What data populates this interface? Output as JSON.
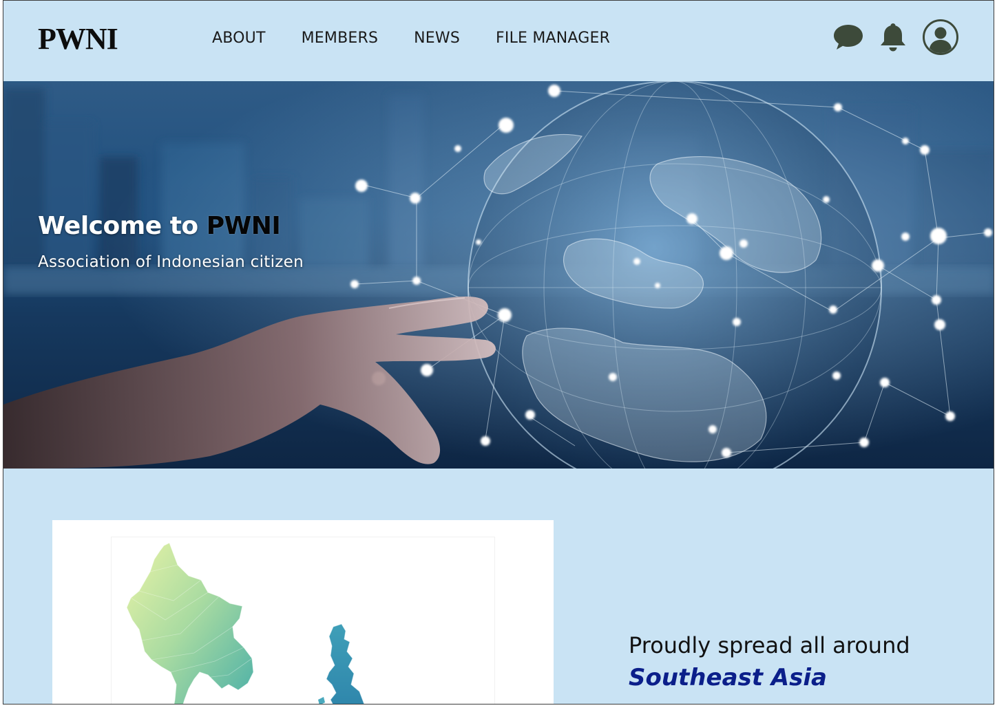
{
  "header": {
    "logo": "PWNI",
    "nav": [
      "ABOUT",
      "MEMBERS",
      "NEWS",
      "FILE MANAGER"
    ],
    "icons": [
      "chat-icon",
      "bell-icon",
      "user-avatar-icon"
    ]
  },
  "hero": {
    "title_prefix": "Welcome to ",
    "title_brand": "PWNI",
    "subtitle": "Association of Indonesian citizen"
  },
  "section": {
    "tagline": "Proudly spread all around",
    "region": "Southeast Asia"
  },
  "colors": {
    "page_bg": "#c9e3f4",
    "region_text": "#0b1f8a",
    "icon_fill": "#3d4a3a"
  }
}
